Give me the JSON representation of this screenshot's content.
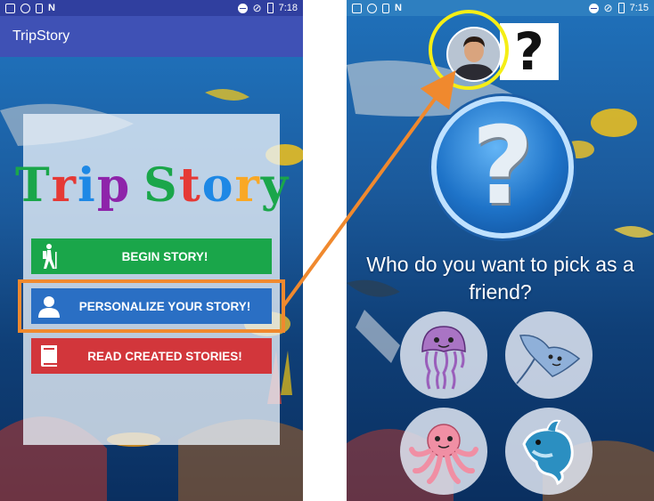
{
  "left_screen": {
    "status_time": "7:18",
    "app_title": "TripStory",
    "logo_letters": [
      "T",
      "r",
      "i",
      "p",
      "S",
      "t",
      "o",
      "r",
      "y"
    ],
    "buttons": {
      "begin": "BEGIN STORY!",
      "personalize": "PERSONALIZE YOUR STORY!",
      "read": "READ CREATED STORIES!"
    }
  },
  "right_screen": {
    "status_time": "7:15",
    "unknown_friend_mark": "?",
    "big_question_mark": "?",
    "question": "Who do you want to pick as a friend?",
    "friends": [
      "jellyfish",
      "stingray",
      "octopus",
      "dolphin"
    ]
  },
  "colors": {
    "begin": "#1aa64a",
    "personalize": "#2a6fc4",
    "read": "#d2363b",
    "highlight": "#f0892e",
    "avatar_ring": "#f5ee15",
    "logo": [
      "#1aa64a",
      "#e53935",
      "#1e88e5",
      "#8e24aa",
      "#1aa64a",
      "#e53935",
      "#1e88e5",
      "#f9a825",
      "#1aa64a"
    ]
  },
  "icons": {
    "begin": "hiker-icon",
    "personalize": "person-icon",
    "read": "book-icon"
  }
}
